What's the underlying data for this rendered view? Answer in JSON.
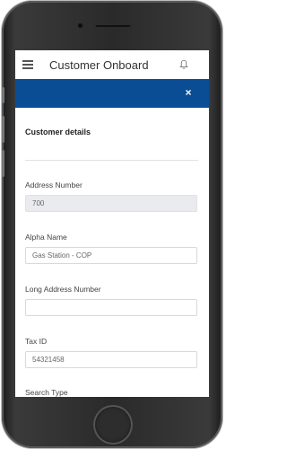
{
  "app": {
    "title": "Customer Onboard"
  },
  "icons": {
    "menu": "hamburger-icon",
    "notifications": "bell-icon",
    "close": "close-icon"
  },
  "colors": {
    "header_blue": "#0a4d95",
    "disabled_field": "#e9ebee"
  },
  "modal": {
    "close_symbol": "×",
    "section_title": "Customer details",
    "fields": [
      {
        "label": "Address Number",
        "value": "700",
        "disabled": true
      },
      {
        "label": "Alpha Name",
        "value": "Gas Station - COP",
        "disabled": false
      },
      {
        "label": "Long Address Number",
        "value": "",
        "disabled": false
      },
      {
        "label": "Tax ID",
        "value": "54321458",
        "disabled": false
      },
      {
        "label": "Search Type",
        "value": "",
        "disabled": false
      }
    ]
  }
}
